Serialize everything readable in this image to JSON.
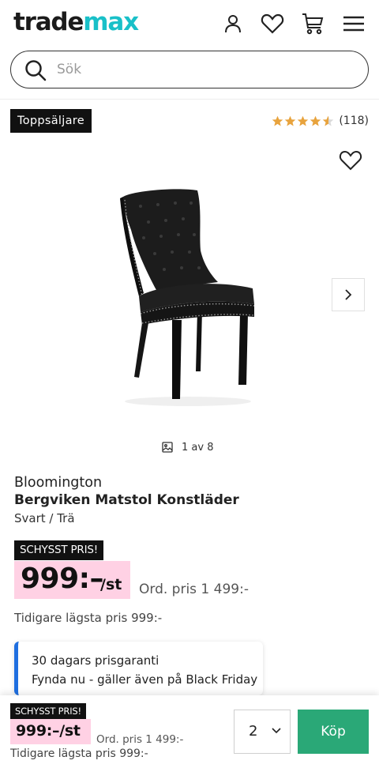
{
  "header": {
    "logo_part1": "trade",
    "logo_part2": "max",
    "icons": [
      "user-icon",
      "heart-icon",
      "cart-icon",
      "menu-icon"
    ]
  },
  "search": {
    "placeholder": "Sök",
    "value": ""
  },
  "product": {
    "badge": "Toppsäljare",
    "rating": {
      "stars": 4.5,
      "count": "(118)"
    },
    "image_counter": "1 av 8",
    "brand": "Bloomington",
    "name": "Bergviken Matstol Konstläder",
    "variant": "Svart / Trä",
    "deal_label": "SCHYSST PRIS!",
    "price": "999:–",
    "price_unit": "/st",
    "ord_price": "Ord. pris 1 499:-",
    "lowest_price": "Tidigare lägsta pris 999:-",
    "guarantee": {
      "line1": "30 dagars prisgaranti",
      "line2": "Fynda nu - gäller även på Black Friday"
    }
  },
  "bottom_bar": {
    "deal_label": "SCHYSST PRIS!",
    "price": "999:–/st",
    "ord_price": "Ord. pris 1 499:-",
    "lowest_price": "Tidigare lägsta pris 999:-",
    "quantity": "2",
    "buy_label": "Köp"
  },
  "colors": {
    "brand_accent": "#19c0c8",
    "price_highlight": "#ffd1e4",
    "buy_button": "#2aa877",
    "star": "#e8a33d",
    "guarantee_accent": "#1f6fe0"
  }
}
